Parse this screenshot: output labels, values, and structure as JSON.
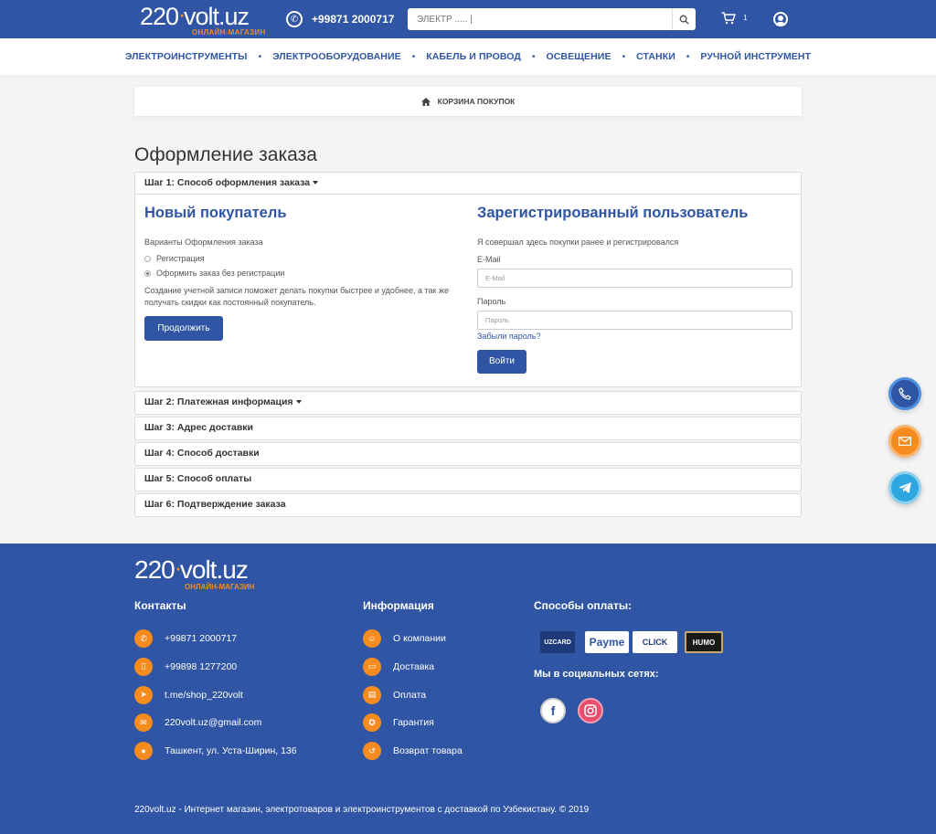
{
  "header": {
    "logo_main_a": "220",
    "logo_main_b": "volt.uz",
    "logo_sub": "ОНЛАЙН-МАГАЗИН",
    "phone": "+99871 2000717",
    "search_placeholder": "ЭЛЕКТР ..... |",
    "cart_count": "1"
  },
  "nav": [
    "ЭЛЕКТРОИНСТРУМЕНТЫ",
    "ЭЛЕКТРООБОРУДОВАНИЕ",
    "КАБЕЛЬ И ПРОВОД",
    "ОСВЕЩЕНИЕ",
    "СТАНКИ",
    "РУЧНОЙ ИНСТРУМЕНТ"
  ],
  "breadcrumb": "КОРЗИНА ПОКУПОК",
  "page_title": "Оформление заказа",
  "step1": {
    "title": "Шаг 1: Способ оформления заказа",
    "new_customer": {
      "heading": "Новый покупатель",
      "options_label": "Варианты Оформления заказа",
      "option_register": "Регистрация",
      "option_guest": "Оформить заказ без регистрации",
      "note": "Создание учетной записи поможет делать покупки быстрее и удобнее, а так же получать скидки как постоянный покупатель.",
      "continue_label": "Продолжить"
    },
    "registered": {
      "heading": "Зарегистрированный пользователь",
      "desc": "Я совершал здесь покупки ранее и регистрировался",
      "email_label": "E-Mail",
      "email_placeholder": "E-Mail",
      "password_label": "Пароль",
      "password_placeholder": "Пароль",
      "forgot": "Забыли пароль?",
      "login_label": "Войти"
    }
  },
  "steps": [
    "Шаг 2: Платежная информация",
    "Шаг 3: Адрес доставки",
    "Шаг 4: Способ доставки",
    "Шаг 5: Способ оплаты",
    "Шаг 6: Подтверждение заказа"
  ],
  "footer": {
    "contacts_title": "Контакты",
    "contacts": [
      "+99871 2000717",
      "+99898 1277200",
      "t.me/shop_220volt",
      "220volt.uz@gmail.com",
      "Ташкент, ул. Уста-Ширин, 136"
    ],
    "info_title": "Информация",
    "info": [
      "О компании",
      "Доставка",
      "Оплата",
      "Гарантия",
      "Возврат товара"
    ],
    "payment_title": "Способы оплаты:",
    "payments": [
      "UZCARD",
      "Payme",
      "CLICK",
      "HUMO"
    ],
    "social_title": "Мы в социальных сетях:",
    "copyright": "220volt.uz - Интернет магазин, электротоваров и электроинструментов с доставкой по Узбекистану. © 2019"
  },
  "colors": {
    "brand_blue": "#2f55a4",
    "accent_orange": "#f68b1f"
  }
}
